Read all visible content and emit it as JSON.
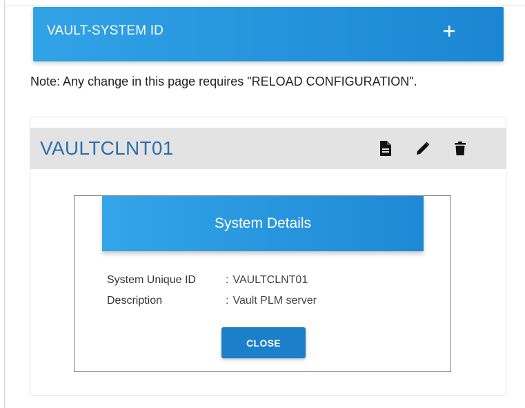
{
  "header": {
    "title": "VAULT-SYSTEM ID",
    "add_icon": "plus-icon"
  },
  "note": "Note: Any change in this page requires \"RELOAD CONFIGURATION\".",
  "card": {
    "title": "VAULTCLNT01",
    "actions": [
      "document-icon",
      "pencil-icon",
      "trash-icon"
    ]
  },
  "dialog": {
    "title": "System Details",
    "rows": [
      {
        "label": "System Unique ID",
        "separator": ":",
        "value": "VAULTCLNT01"
      },
      {
        "label": "Description",
        "separator": ":",
        "value": "Vault PLM server"
      }
    ],
    "close_label": "CLOSE"
  },
  "colors": {
    "accent_blue": "#1e89d5",
    "card_title": "#2b6fb0",
    "card_header_bg": "#e3e3e3"
  }
}
